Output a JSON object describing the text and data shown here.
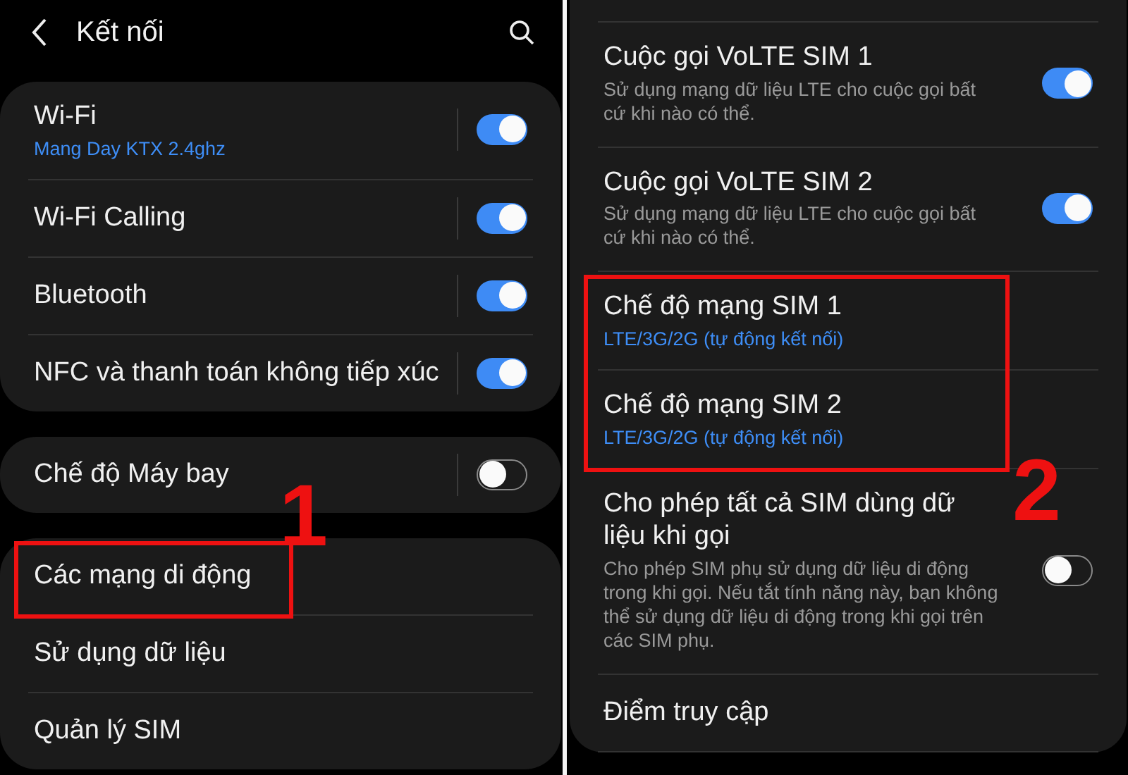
{
  "left": {
    "header": {
      "title": "Kết nối"
    },
    "annotation": "1",
    "cards": [
      {
        "rows": [
          {
            "kind": "toggle",
            "title": "Wi-Fi",
            "subtitle": "Mang Day KTX 2.4ghz",
            "on": true,
            "marked": false
          },
          {
            "kind": "toggle",
            "title": "Wi-Fi Calling",
            "on": true,
            "marked": false
          },
          {
            "kind": "toggle",
            "title": "Bluetooth",
            "on": true,
            "marked": false
          },
          {
            "kind": "toggle",
            "title": "NFC và thanh toán không tiếp xúc",
            "on": true,
            "marked": false
          }
        ]
      },
      {
        "rows": [
          {
            "kind": "toggle",
            "title": "Chế độ Máy bay",
            "on": false,
            "marked": false
          }
        ]
      },
      {
        "rows": [
          {
            "kind": "link",
            "title": "Các mạng di động",
            "marked": true
          },
          {
            "kind": "link",
            "title": "Sử dụng dữ liệu",
            "marked": false
          },
          {
            "kind": "link",
            "title": "Quản lý SIM",
            "marked": false
          }
        ]
      }
    ]
  },
  "right": {
    "annotation": "2",
    "rows": [
      {
        "kind": "toggle",
        "title": "Cuộc gọi VoLTE SIM 1",
        "description": "Sử dụng mạng dữ liệu LTE cho cuộc gọi bất cứ khi nào có thể.",
        "on": true,
        "marked": false
      },
      {
        "kind": "toggle",
        "title": "Cuộc gọi VoLTE SIM 2",
        "description": "Sử dụng mạng dữ liệu LTE cho cuộc gọi bất cứ khi nào có thể.",
        "on": true,
        "marked": false
      },
      {
        "kind": "link",
        "title": "Chế độ mạng SIM 1",
        "subtitle": "LTE/3G/2G (tự động kết nối)",
        "marked": true
      },
      {
        "kind": "link",
        "title": "Chế độ mạng SIM 2",
        "subtitle": "LTE/3G/2G (tự động kết nối)",
        "marked": true
      },
      {
        "kind": "toggle",
        "title": "Cho phép tất cả SIM dùng dữ liệu khi gọi",
        "description": "Cho phép SIM phụ sử dụng dữ liệu di động trong khi gọi. Nếu tắt tính năng này, bạn không thể sử dụng dữ liệu di động trong khi gọi trên các SIM phụ.",
        "on": false,
        "marked": false
      },
      {
        "kind": "link",
        "title": "Điểm truy cập",
        "marked": false
      }
    ]
  }
}
